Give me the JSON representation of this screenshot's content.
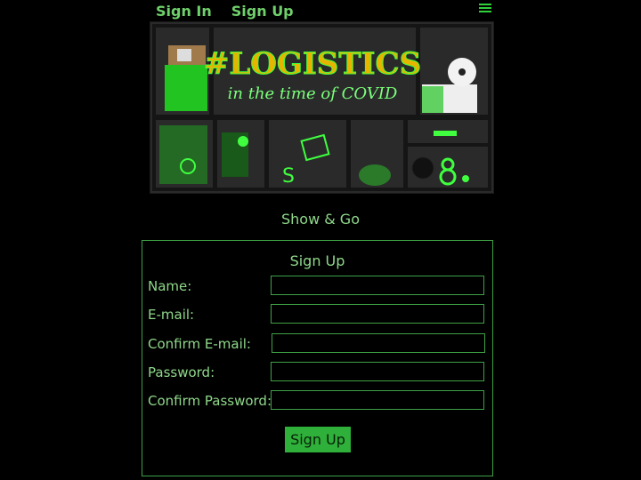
{
  "nav": {
    "sign_in": "Sign In",
    "sign_up": "Sign Up"
  },
  "banner": {
    "hashtag": "#LOGISTICS",
    "tagline": "in the time of COVID"
  },
  "app_title": "Show & Go",
  "form": {
    "title": "Sign Up",
    "fields": [
      {
        "label": "Name:",
        "value": ""
      },
      {
        "label": "E-mail:",
        "value": ""
      },
      {
        "label": "Confirm E-mail:",
        "value": ""
      },
      {
        "label": "Password:",
        "value": ""
      },
      {
        "label": "Confirm Password:",
        "value": ""
      }
    ],
    "submit_label": "Sign Up"
  },
  "colors": {
    "accent": "#2fb03a",
    "text": "#8fd88a",
    "background": "#000000"
  }
}
